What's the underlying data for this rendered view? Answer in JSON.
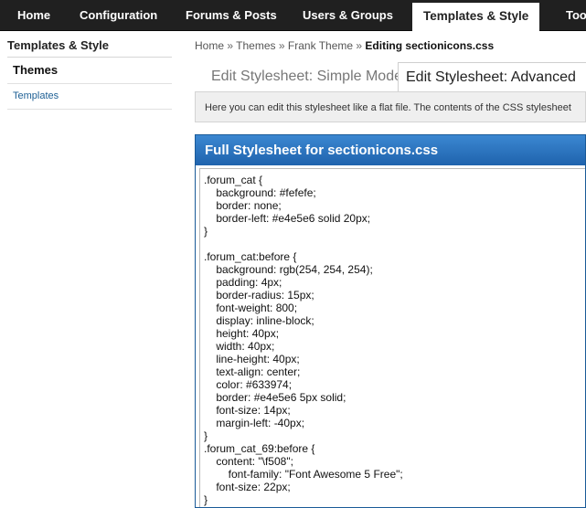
{
  "topnav": {
    "tabs": [
      {
        "label": "Home"
      },
      {
        "label": "Configuration"
      },
      {
        "label": "Forums & Posts"
      },
      {
        "label": "Users & Groups"
      },
      {
        "label": "Templates & Style"
      },
      {
        "label": "Too"
      }
    ],
    "active": "Templates & Style"
  },
  "sidebar": {
    "title": "Templates & Style",
    "items": [
      {
        "label": "Themes"
      },
      {
        "label": "Templates"
      }
    ]
  },
  "breadcrumb": {
    "items": [
      "Home",
      "Themes",
      "Frank Theme"
    ],
    "separator": "»",
    "current": "Editing sectionicons.css"
  },
  "mode_tabs": {
    "simple": "Edit Stylesheet: Simple Mode",
    "advanced": "Edit Stylesheet: Advanced"
  },
  "info": "Here you can edit this stylesheet like a flat file. The contents of the CSS stylesheet",
  "panel": {
    "title": "Full Stylesheet for sectionicons.css"
  },
  "code_lines": [
    ".forum_cat {",
    "    background: #fefefe;",
    "    border: none;",
    "    border-left: #e4e5e6 solid 20px;",
    "}",
    "",
    ".forum_cat:before {",
    "    background: rgb(254, 254, 254);",
    "    padding: 4px;",
    "    border-radius: 15px;",
    "    font-weight: 800;",
    "    display: inline-block;",
    "    height: 40px;",
    "    width: 40px;",
    "    line-height: 40px;",
    "    text-align: center;",
    "    color: #633974;",
    "    border: #e4e5e6 5px solid;",
    "    font-size: 14px;",
    "    margin-left: -40px;",
    "}",
    ".forum_cat_69:before {",
    "    content: \"\\f508\";",
    "        font-family: \"Font Awesome 5 Free\";",
    "    font-size: 22px;",
    "}"
  ],
  "colors": {
    "nav_bg": "#202020",
    "panel_header": "#1f63ad",
    "link": "#1d5f94"
  }
}
